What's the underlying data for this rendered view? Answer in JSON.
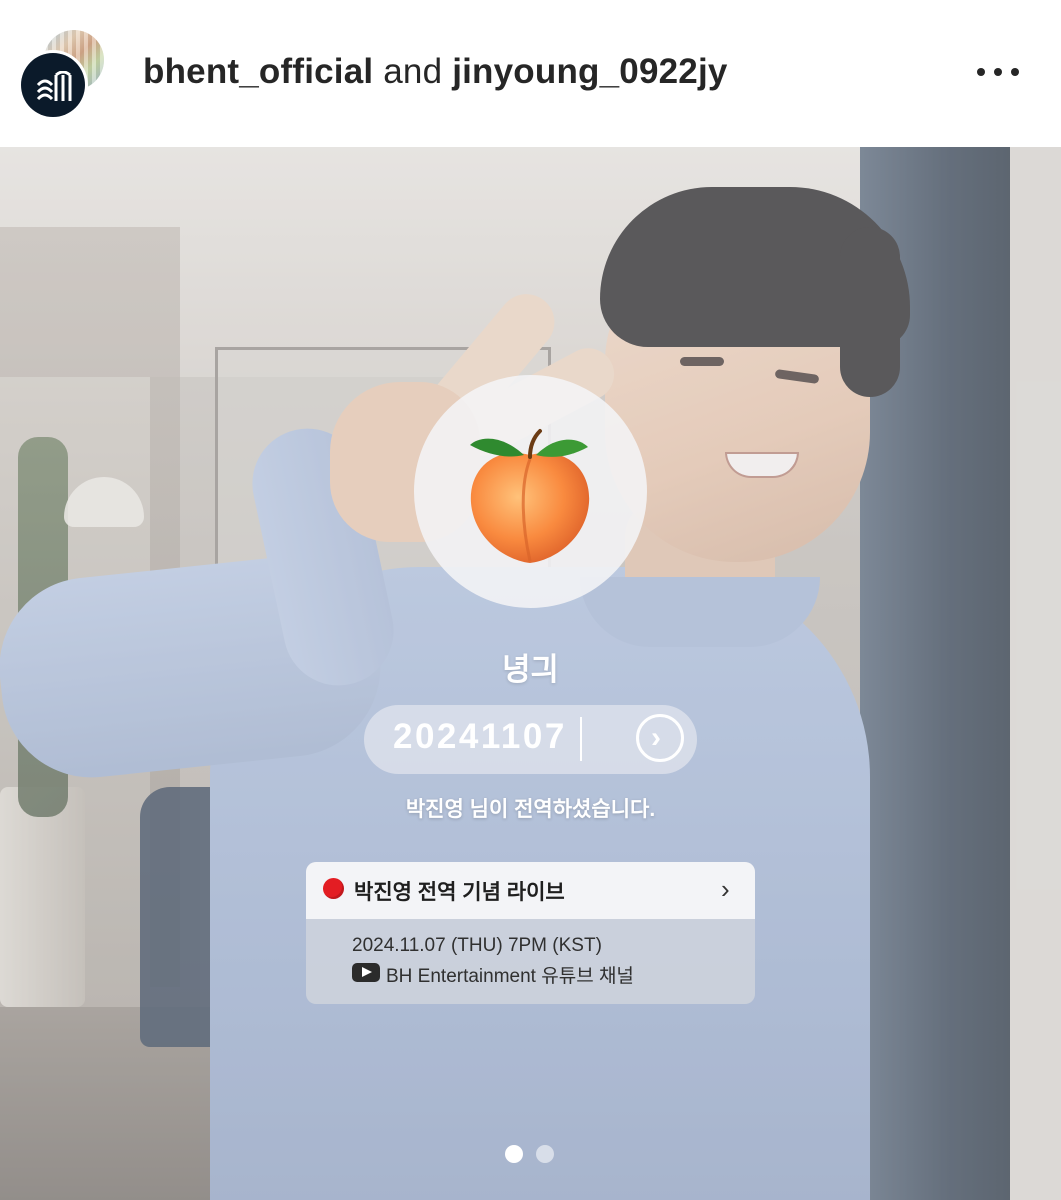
{
  "header": {
    "owner_username": "bhent_official",
    "connector": "and",
    "collab_username": "jinyoung_0922jy",
    "more_icon": "more-horizontal-icon"
  },
  "post": {
    "emoji": "peach",
    "nickname": "녕긔",
    "date_input_value": "20241107",
    "submit_icon": "chevron-right-circle-icon",
    "message": "박진영 님이 전역하셨습니다.",
    "live_card": {
      "status_icon": "red-circle-icon",
      "title": "박진영 전역 기념 라이브",
      "datetime": "2024.11.07 (THU) 7PM (KST)",
      "platform_icon": "youtube-icon",
      "channel": "BH Entertainment 유튜브 채널",
      "live_color": "#e31d23"
    },
    "carousel": {
      "total": 2,
      "current": 1
    }
  }
}
